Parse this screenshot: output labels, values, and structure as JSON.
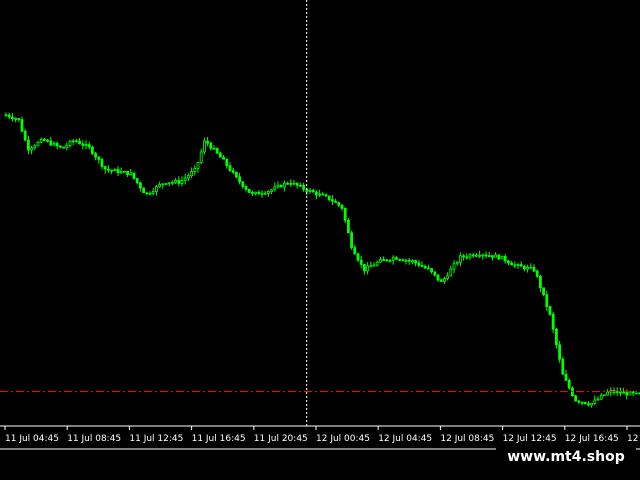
{
  "colors": {
    "background": "#000000",
    "candle": "#00ff00",
    "axis": "#ffffff",
    "crosshair": "#ffffff",
    "level_line": "#ff0000",
    "label": "#ffffff"
  },
  "chart_data": {
    "type": "line",
    "title": "",
    "xlabel": "",
    "ylabel": "",
    "grid": false,
    "time_labels": [
      "11 Jul 04:45",
      "11 Jul 08:45",
      "11 Jul 12:45",
      "11 Jul 16:45",
      "11 Jul 20:45",
      "12 Jul 00:45",
      "12 Jul 04:45",
      "12 Jul 08:45",
      "12 Jul 12:45",
      "12 Jul 16:45",
      "12 "
    ],
    "ylim": [
      0,
      100
    ],
    "crosshair_label_index": 4.85,
    "level_line_value": 8,
    "series": [
      {
        "price_path": [
          [
            0,
            74
          ],
          [
            0.2,
            73
          ],
          [
            0.35,
            66
          ],
          [
            0.6,
            68
          ],
          [
            0.9,
            66
          ],
          [
            1.1,
            68
          ],
          [
            1.35,
            66
          ],
          [
            1.6,
            61
          ],
          [
            2.0,
            60
          ],
          [
            2.25,
            55
          ],
          [
            2.55,
            58
          ],
          [
            2.8,
            58
          ],
          [
            3.05,
            61
          ],
          [
            3.2,
            68
          ],
          [
            3.5,
            63
          ],
          [
            3.7,
            59
          ],
          [
            3.95,
            55
          ],
          [
            4.25,
            56
          ],
          [
            4.55,
            58
          ],
          [
            4.85,
            56
          ],
          [
            5.2,
            54
          ],
          [
            5.4,
            52
          ],
          [
            5.55,
            43
          ],
          [
            5.75,
            37
          ],
          [
            6.0,
            39
          ],
          [
            6.25,
            40
          ],
          [
            6.55,
            39
          ],
          [
            6.8,
            37
          ],
          [
            7.0,
            34
          ],
          [
            7.3,
            40
          ],
          [
            7.6,
            41
          ],
          [
            7.95,
            40
          ],
          [
            8.2,
            38
          ],
          [
            8.5,
            37
          ],
          [
            8.75,
            26
          ],
          [
            8.95,
            12
          ],
          [
            9.15,
            6
          ],
          [
            9.4,
            5
          ],
          [
            9.7,
            8
          ],
          [
            10.3,
            7
          ]
        ]
      }
    ]
  },
  "watermark": {
    "text": "www.mt4.shop"
  }
}
